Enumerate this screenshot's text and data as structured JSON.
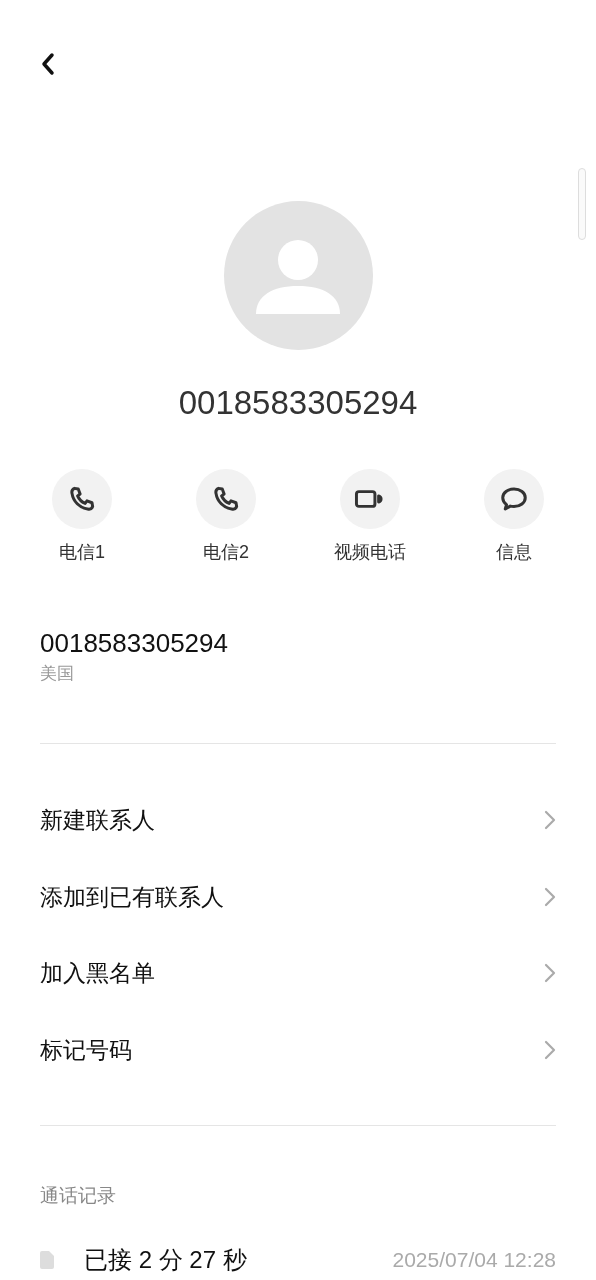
{
  "contact": {
    "number": "0018583305294"
  },
  "actions": [
    {
      "kind": "phone",
      "label": "电信1"
    },
    {
      "kind": "phone",
      "label": "电信2"
    },
    {
      "kind": "video",
      "label": "视频电话"
    },
    {
      "kind": "message",
      "label": "信息"
    }
  ],
  "number_info": {
    "number": "0018583305294",
    "location": "美国"
  },
  "menu": [
    {
      "label": "新建联系人"
    },
    {
      "label": "添加到已有联系人"
    },
    {
      "label": "加入黑名单"
    },
    {
      "label": "标记号码"
    }
  ],
  "call_log": {
    "title": "通话记录",
    "entries": [
      {
        "status": "已接 2 分 27 秒",
        "time": "2025/07/04 12:28"
      }
    ]
  }
}
